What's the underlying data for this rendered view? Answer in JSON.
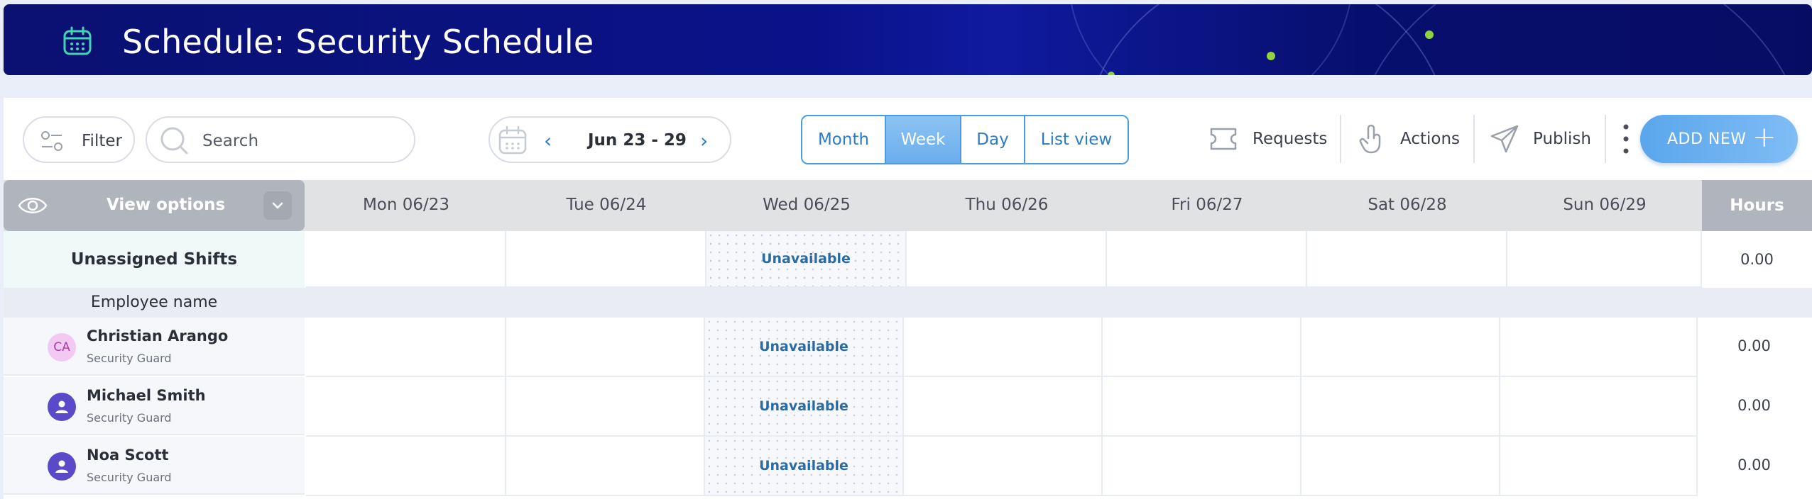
{
  "header": {
    "title": "Schedule: Security Schedule",
    "icon": "calendar-icon"
  },
  "toolbar": {
    "filter_label": "Filter",
    "search_placeholder": "Search",
    "date_range": "Jun 23 - 29",
    "views": [
      "Month",
      "Week",
      "Day",
      "List view"
    ],
    "active_view": "Week",
    "requests_label": "Requests",
    "actions_label": "Actions",
    "publish_label": "Publish",
    "add_new_label": "ADD NEW",
    "add_new_plus": "+"
  },
  "grid": {
    "view_options_label": "View options",
    "days": [
      "Mon 06/23",
      "Tue 06/24",
      "Wed 06/25",
      "Thu 06/26",
      "Fri 06/27",
      "Sat 06/28",
      "Sun 06/29"
    ],
    "hours_label": "Hours",
    "unassigned_label": "Unassigned Shifts",
    "unassigned_hours": "0.00",
    "unavailable_label": "Unavailable",
    "employee_name_label": "Employee name",
    "employees": [
      {
        "initials": "CA",
        "name": "Christian Arango",
        "role": "Security Guard",
        "hours": "0.00",
        "avatar": "initials"
      },
      {
        "name": "Michael Smith",
        "role": "Security Guard",
        "hours": "0.00",
        "avatar": "person-icon"
      },
      {
        "name": "Noa Scott",
        "role": "Security Guard",
        "hours": "0.00",
        "avatar": "person-icon"
      }
    ]
  },
  "colors": {
    "banner": "#0a128a",
    "accent": "#2b7cc6",
    "add_new": "#6aaeee",
    "unassigned_bg": "#eef9f8"
  }
}
